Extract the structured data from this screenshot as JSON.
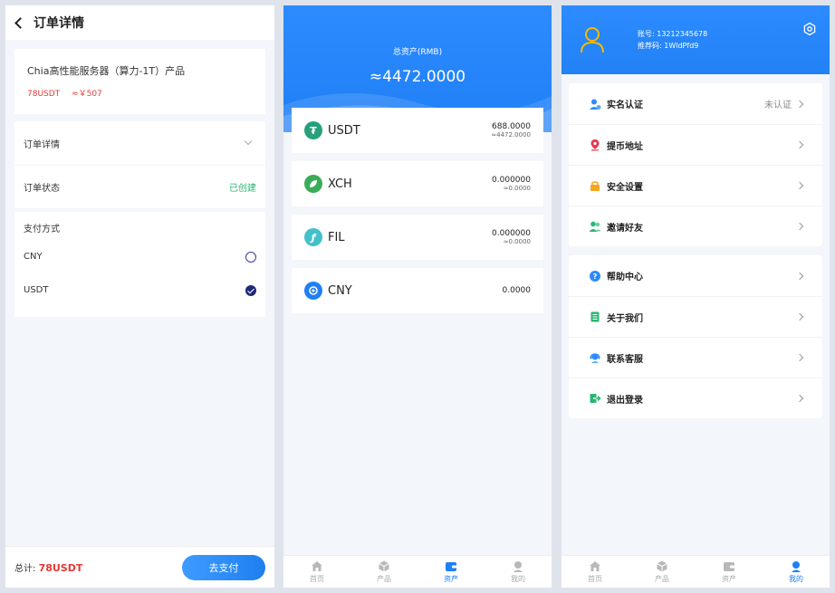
{
  "order": {
    "title": "订单详情",
    "product_name": "Chia高性能服务器（算力-1T）产品",
    "price_usdt": "78USDT",
    "price_cny": "≈￥507",
    "detail_label": "订单详情",
    "status_label": "订单状态",
    "status_value": "已创建",
    "pay_method_label": "支付方式",
    "pay_options": [
      "CNY",
      "USDT"
    ],
    "selected_pay": "USDT",
    "total_label": "总计:",
    "total_value": "78USDT",
    "pay_button": "去支付"
  },
  "assets": {
    "total_label": "总资产(RMB)",
    "total_value": "≈4472.0000",
    "items": [
      {
        "name": "USDT",
        "amount": "688.0000",
        "sub": "≈4472.0000",
        "icon": "usdt-icon",
        "color": "#26a17b"
      },
      {
        "name": "XCH",
        "amount": "0.000000",
        "sub": "≈0.0000",
        "icon": "xch-leaf-icon",
        "color": "#3aac59"
      },
      {
        "name": "FIL",
        "amount": "0.000000",
        "sub": "≈0.0000",
        "icon": "fil-icon",
        "color": "#42c1ca"
      },
      {
        "name": "CNY",
        "amount": "0.0000",
        "sub": "",
        "icon": "cny-icon",
        "color": "#1f7ff5"
      }
    ]
  },
  "tabbar": {
    "tabs": [
      "首页",
      "产品",
      "资产",
      "我的"
    ]
  },
  "profile": {
    "account_label": "账号:",
    "account_value": "13212345678",
    "ref_label": "推荐码:",
    "ref_value": "1WldPfd9",
    "group1": [
      {
        "label": "实名认证",
        "value": "未认证",
        "icon": "user-verify-icon",
        "color": "#2d8bff"
      },
      {
        "label": "提币地址",
        "value": "",
        "icon": "location-pin-icon",
        "color": "#e53950"
      },
      {
        "label": "安全设置",
        "value": "",
        "icon": "lock-icon",
        "color": "#f5a623"
      },
      {
        "label": "邀请好友",
        "value": "",
        "icon": "invite-friends-icon",
        "color": "#2bb673"
      }
    ],
    "group2": [
      {
        "label": "帮助中心",
        "icon": "help-icon",
        "color": "#2d8bff"
      },
      {
        "label": "关于我们",
        "icon": "about-book-icon",
        "color": "#2bb673"
      },
      {
        "label": "联系客服",
        "icon": "customer-service-icon",
        "color": "#2d8bff"
      },
      {
        "label": "退出登录",
        "icon": "logout-icon",
        "color": "#2bb673"
      }
    ]
  },
  "colors": {
    "primary": "#1f7ff5",
    "danger": "#e53935",
    "success": "#2bb673"
  }
}
